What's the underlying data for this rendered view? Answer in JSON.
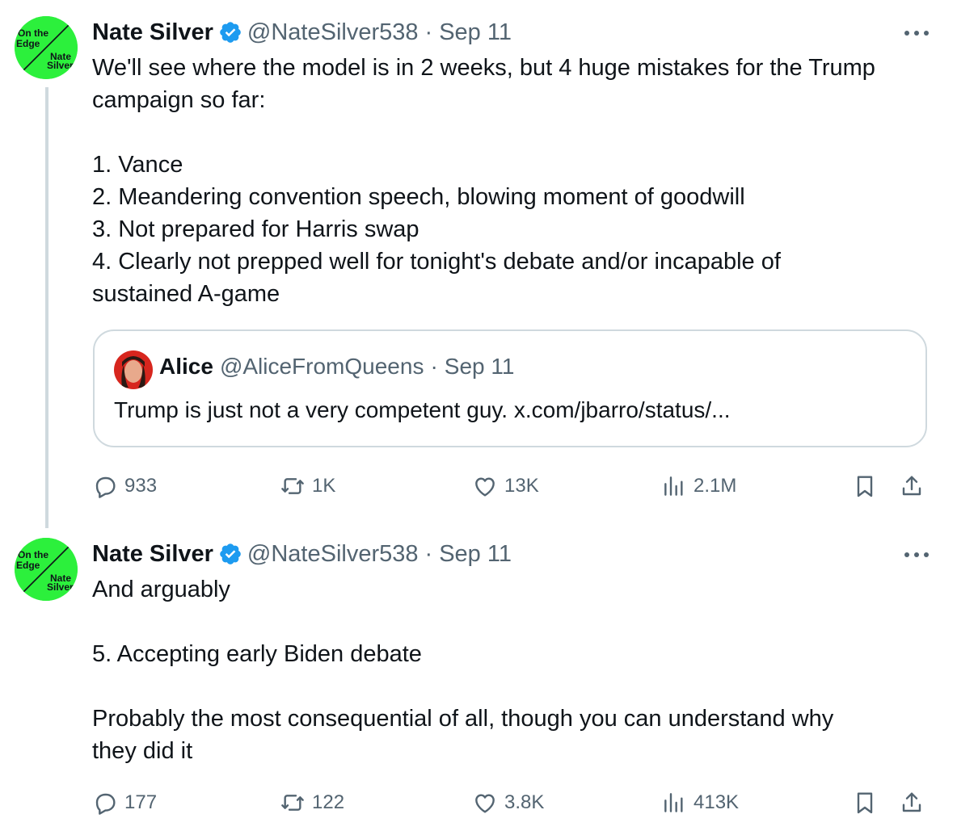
{
  "tweets": [
    {
      "author_name": "Nate Silver",
      "handle": "@NateSilver538",
      "separator": "·",
      "date": "Sep 11",
      "avatar_text": {
        "left": "On the\nEdge",
        "right": "Nate\nSilver"
      },
      "text": "We'll see where the model is in 2 weeks, but 4 huge mistakes for the Trump\ncampaign so far:\n\n1. Vance\n2. Meandering convention speech, blowing moment of goodwill\n3. Not prepared for Harris swap\n4. Clearly not prepped well for tonight's debate and/or incapable of\nsustained A-game",
      "quote": {
        "author_name": "Alice",
        "handle": "@AliceFromQueens",
        "separator": "·",
        "date": "Sep 11",
        "text": "Trump is just not a very competent guy. x.com/jbarro/status/..."
      },
      "stats": {
        "replies": "933",
        "reposts": "1K",
        "likes": "13K",
        "views": "2.1M"
      }
    },
    {
      "author_name": "Nate Silver",
      "handle": "@NateSilver538",
      "separator": "·",
      "date": "Sep 11",
      "avatar_text": {
        "left": "On the\nEdge",
        "right": "Nate\nSilver"
      },
      "text": "And arguably\n\n5. Accepting early Biden debate\n\nProbably the most consequential of all, though you can understand why\nthey did it",
      "stats": {
        "replies": "177",
        "reposts": "122",
        "likes": "3.8K",
        "views": "413K"
      }
    }
  ],
  "icons": {
    "verified": "verified-badge-icon",
    "more": "more-options-icon",
    "reply": "reply-icon",
    "repost": "repost-icon",
    "like": "like-icon",
    "views": "views-icon",
    "bookmark": "bookmark-icon",
    "share": "share-icon"
  },
  "colors": {
    "brand_green": "#2cf03c",
    "verified_blue": "#1d9bf0",
    "muted": "#536471",
    "border": "#cfd9de"
  }
}
